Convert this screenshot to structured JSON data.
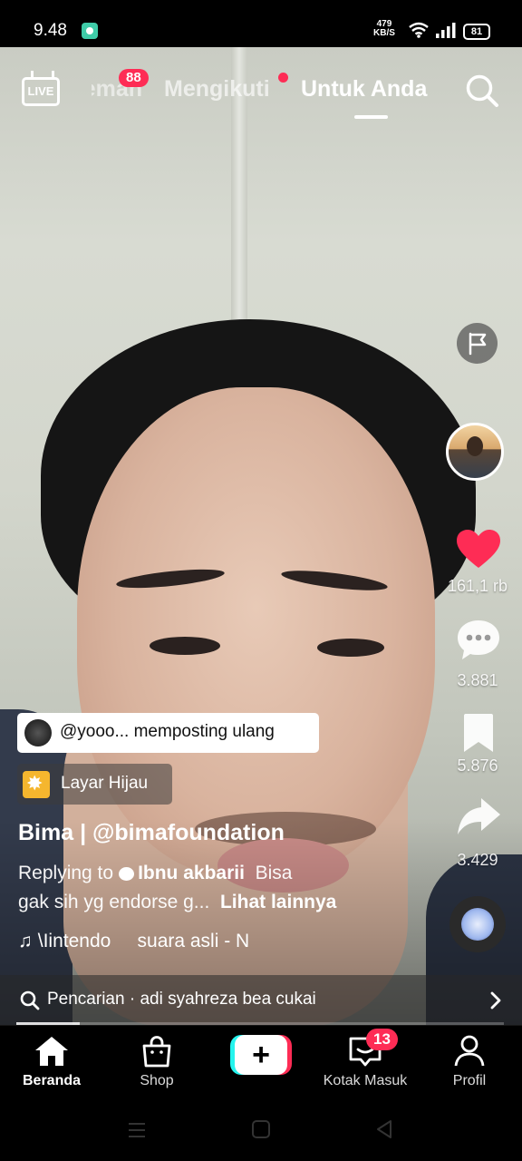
{
  "status_bar": {
    "time": "9.48",
    "net_speed_value": "479",
    "net_speed_unit": "KB/S",
    "battery": "81"
  },
  "top_nav": {
    "live_label": "LIVE",
    "tabs": [
      {
        "label": "Teman"
      },
      {
        "label": "Mengikuti"
      },
      {
        "label": "Untuk Anda"
      }
    ],
    "friends_badge": "88"
  },
  "right_rail": {
    "likes": "161,1 rb",
    "comments": "3.881",
    "bookmarks": "5.876",
    "shares": "3.429",
    "like_color": "#fe2c55"
  },
  "post": {
    "repost_text": "@yooo... memposting ulang",
    "effect_label": "Layar Hijau",
    "author": "Bima | @bimafoundation",
    "caption_prefix": "Replying to",
    "reply_user": "Ibnu akbarii",
    "caption_rest_line1": "Bisa",
    "caption_line2": "gak sih yg endorse g...",
    "see_more": "Lihat lainnya",
    "music_artist": "\\Iintendo",
    "music_title": "suara asli - N"
  },
  "search_bar": {
    "text": "Pencarian · adi syahreza bea cukai"
  },
  "progress": 0.13,
  "bottom_nav": {
    "items": [
      {
        "label": "Beranda",
        "icon": "home-icon"
      },
      {
        "label": "Shop",
        "icon": "shop-bag-icon"
      },
      {
        "label": "",
        "icon": "plus-icon"
      },
      {
        "label": "Kotak Masuk",
        "icon": "inbox-icon"
      },
      {
        "label": "Profil",
        "icon": "profile-icon"
      }
    ],
    "inbox_badge": "13"
  }
}
